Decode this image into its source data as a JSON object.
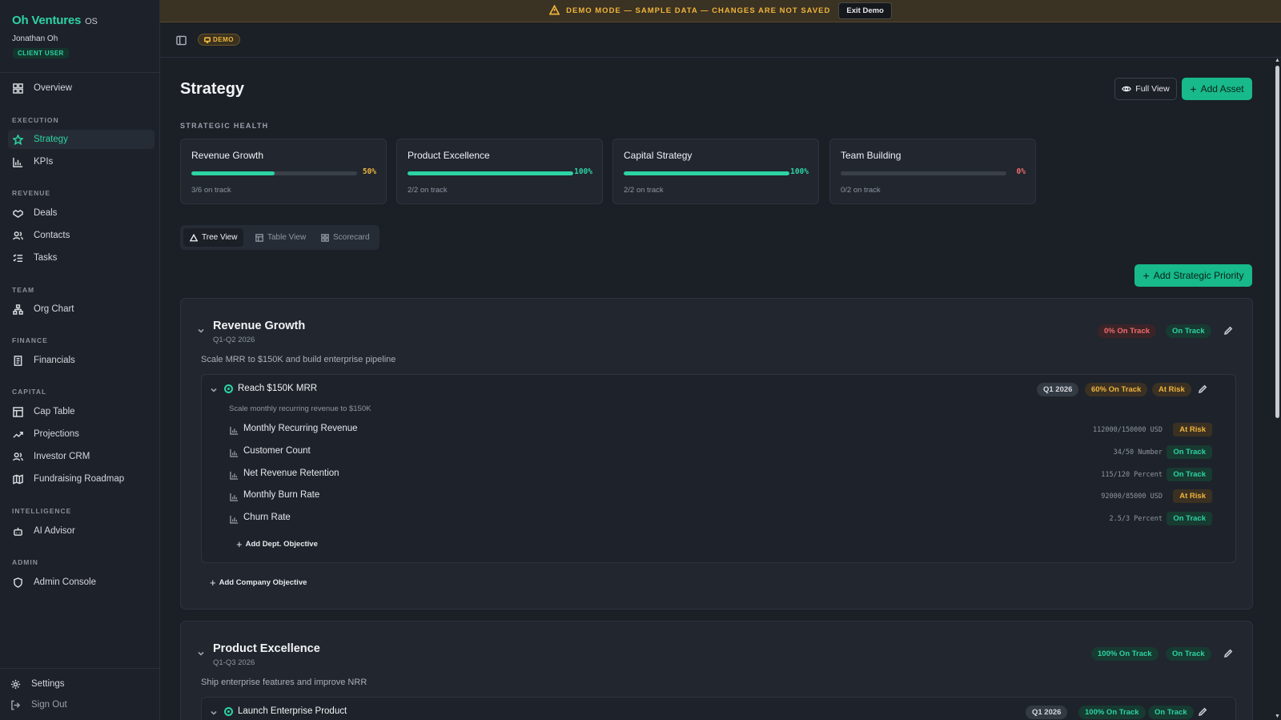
{
  "brand": {
    "name": "Oh Ventures",
    "suffix": "OS"
  },
  "user": {
    "name": "Jonathan Oh",
    "role": "CLIENT USER"
  },
  "nav": {
    "overview": "Overview",
    "sections": {
      "execution": "EXECUTION",
      "revenue": "REVENUE",
      "team": "TEAM",
      "finance": "FINANCE",
      "capital": "CAPITAL",
      "intelligence": "INTELLIGENCE",
      "admin": "ADMIN"
    },
    "items": {
      "strategy": "Strategy",
      "kpis": "KPIs",
      "deals": "Deals",
      "contacts": "Contacts",
      "tasks": "Tasks",
      "org_chart": "Org Chart",
      "financials": "Financials",
      "cap_table": "Cap Table",
      "projections": "Projections",
      "investor_crm": "Investor CRM",
      "fundraising_roadmap": "Fundraising Roadmap",
      "ai_advisor": "AI Advisor",
      "admin_console": "Admin Console"
    },
    "settings": "Settings",
    "sign_out": "Sign Out"
  },
  "banner": {
    "text": "DEMO MODE — SAMPLE DATA — CHANGES ARE NOT SAVED",
    "exit_label": "Exit Demo"
  },
  "topbar": {
    "demo_pill": "DEMO"
  },
  "page": {
    "title": "Strategy",
    "full_view_label": "Full View",
    "add_asset_label": "Add Asset",
    "health_label": "STRATEGIC HEALTH",
    "add_priority_label": "Add Strategic Priority"
  },
  "colors": {
    "accent": "#2dd4a3",
    "warning": "#f0b43c",
    "danger": "#f16b6b"
  },
  "health_cards": [
    {
      "title": "Revenue Growth",
      "percent": 50,
      "percent_label": "50%",
      "sub": "3/6 on track",
      "pct_color": "#f0b43c"
    },
    {
      "title": "Product Excellence",
      "percent": 100,
      "percent_label": "100%",
      "sub": "2/2 on track",
      "pct_color": "#2dd4a3"
    },
    {
      "title": "Capital Strategy",
      "percent": 100,
      "percent_label": "100%",
      "sub": "2/2 on track",
      "pct_color": "#2dd4a3"
    },
    {
      "title": "Team Building",
      "percent": 0,
      "percent_label": "0%",
      "sub": "0/2 on track",
      "pct_color": "#f16b6b"
    }
  ],
  "view_tabs": [
    "Tree View",
    "Table View",
    "Scorecard"
  ],
  "priorities": [
    {
      "title": "Revenue Growth",
      "period": "Q1-Q2 2026",
      "description": "Scale MRR to $150K and build enterprise pipeline",
      "progress_badge": "0% On Track",
      "status_badge": "On Track",
      "objective": {
        "title": "Reach $150K MRR",
        "description": "Scale monthly recurring revenue to $150K",
        "quarter": "Q1 2026",
        "progress": "60% On Track",
        "status": "At Risk",
        "kpis": [
          {
            "name": "Monthly Recurring Revenue",
            "value": "112000/150000 USD",
            "status": "At Risk"
          },
          {
            "name": "Customer Count",
            "value": "34/50 Number",
            "status": "On Track"
          },
          {
            "name": "Net Revenue Retention",
            "value": "115/120 Percent",
            "status": "On Track"
          },
          {
            "name": "Monthly Burn Rate",
            "value": "92000/85000 USD",
            "status": "At Risk"
          },
          {
            "name": "Churn Rate",
            "value": "2.5/3 Percent",
            "status": "On Track"
          }
        ],
        "add_dept_label": "Add Dept. Objective"
      },
      "add_company_label": "Add Company Objective"
    },
    {
      "title": "Product Excellence",
      "period": "Q1-Q3 2026",
      "description": "Ship enterprise features and improve NRR",
      "progress_badge": "100% On Track",
      "status_badge": "On Track",
      "objective": {
        "title": "Launch Enterprise Product",
        "quarter": "Q1 2026",
        "progress": "100% On Track",
        "status": "On Track"
      }
    }
  ]
}
